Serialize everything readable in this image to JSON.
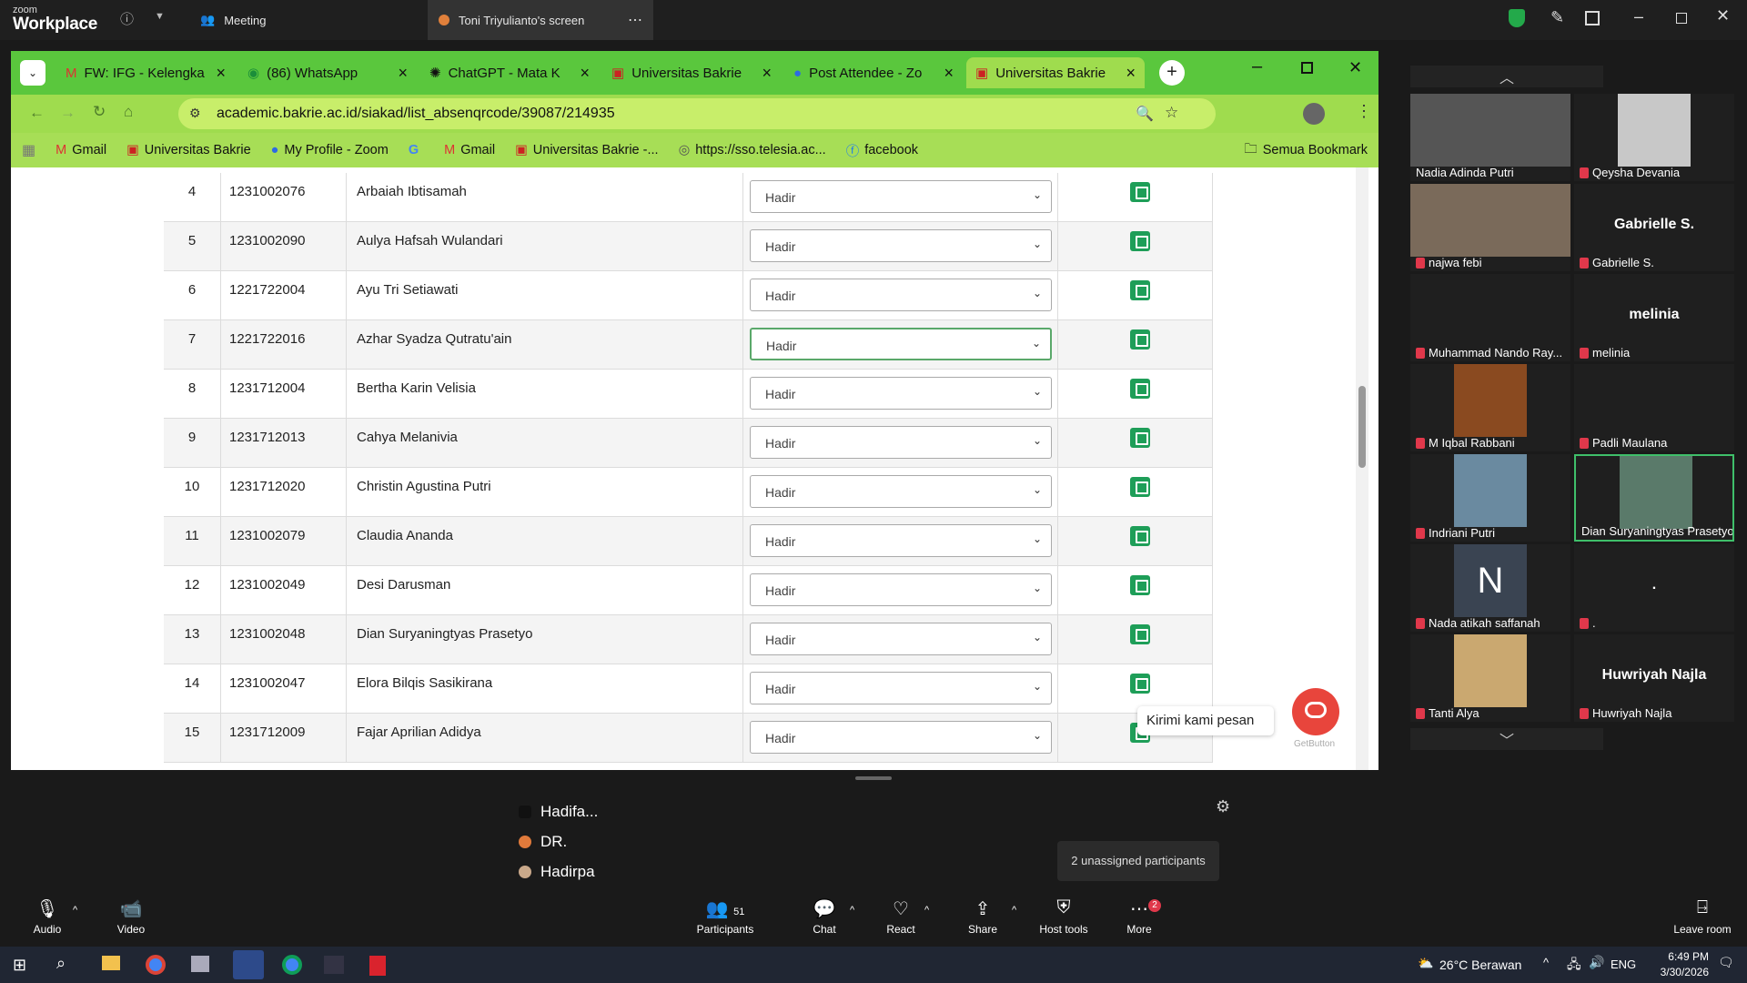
{
  "zoom": {
    "logo_top": "zoom",
    "logo_bottom": "Workplace",
    "meeting_tab": "Meeting",
    "share_tab": "Toni Triyulianto's screen"
  },
  "browser": {
    "tabs": [
      {
        "label": "FW: IFG - Kelengka"
      },
      {
        "label": "(86) WhatsApp"
      },
      {
        "label": "ChatGPT - Mata K"
      },
      {
        "label": "Universitas Bakrie"
      },
      {
        "label": "Post Attendee - Zo"
      },
      {
        "label": "Universitas Bakrie"
      }
    ],
    "url": "academic.bakrie.ac.id/siakad/list_absenqrcode/39087/214935",
    "bookmarks": [
      {
        "label": "Gmail"
      },
      {
        "label": "Universitas Bakrie"
      },
      {
        "label": "My Profile - Zoom"
      },
      {
        "label": ""
      },
      {
        "label": "Gmail"
      },
      {
        "label": "Universitas Bakrie -..."
      },
      {
        "label": "https://sso.telesia.ac..."
      },
      {
        "label": "facebook"
      }
    ],
    "bookmark_folder": "Semua Bookmark",
    "select_options": [
      "Hadir"
    ],
    "students": [
      {
        "no": "4",
        "nim": "1231002076",
        "name": "Arbaiah Ibtisamah",
        "status": "Hadir"
      },
      {
        "no": "5",
        "nim": "1231002090",
        "name": "Aulya Hafsah Wulandari",
        "status": "Hadir"
      },
      {
        "no": "6",
        "nim": "1221722004",
        "name": "Ayu Tri Setiawati",
        "status": "Hadir"
      },
      {
        "no": "7",
        "nim": "1221722016",
        "name": "Azhar Syadza Qutratu'ain",
        "status": "Hadir"
      },
      {
        "no": "8",
        "nim": "1231712004",
        "name": "Bertha Karin Velisia",
        "status": "Hadir"
      },
      {
        "no": "9",
        "nim": "1231712013",
        "name": "Cahya Melanivia",
        "status": "Hadir"
      },
      {
        "no": "10",
        "nim": "1231712020",
        "name": "Christin Agustina Putri",
        "status": "Hadir"
      },
      {
        "no": "11",
        "nim": "1231002079",
        "name": "Claudia Ananda",
        "status": "Hadir"
      },
      {
        "no": "12",
        "nim": "1231002049",
        "name": "Desi Darusman",
        "status": "Hadir"
      },
      {
        "no": "13",
        "nim": "1231002048",
        "name": "Dian Suryaningtyas Prasetyo",
        "status": "Hadir"
      },
      {
        "no": "14",
        "nim": "1231002047",
        "name": "Elora Bilqis Sasikirana",
        "status": "Hadir"
      },
      {
        "no": "15",
        "nim": "1231712009",
        "name": "Fajar Aprilian Adidya",
        "status": "Hadir"
      }
    ],
    "chat_widget": "Kirimi kami pesan",
    "chat_brand": "GetButton"
  },
  "gallery": [
    {
      "name": "Nadia Adinda Putri",
      "muted": false,
      "big": ""
    },
    {
      "name": "Qeysha Devania",
      "muted": true,
      "big": ""
    },
    {
      "name": "najwa febi",
      "muted": true,
      "big": ""
    },
    {
      "name": "Gabrielle S.",
      "muted": true,
      "big": "Gabrielle S."
    },
    {
      "name": "Muhammad Nando Ray...",
      "muted": true,
      "big": ""
    },
    {
      "name": "melinia",
      "muted": true,
      "big": "melinia"
    },
    {
      "name": "M Iqbal Rabbani",
      "muted": true,
      "big": ""
    },
    {
      "name": "Padli Maulana",
      "muted": true,
      "big": ""
    },
    {
      "name": "Indriani Putri",
      "muted": true,
      "big": ""
    },
    {
      "name": "Dian Suryaningtyas Prasetyo",
      "muted": false,
      "big": ""
    },
    {
      "name": "Nada atikah saffanah",
      "muted": true,
      "big": "",
      "initial": "N"
    },
    {
      "name": ".",
      "muted": true,
      "big": "."
    },
    {
      "name": "Tanti Alya",
      "muted": true,
      "big": ""
    },
    {
      "name": "Huwriyah Najla",
      "muted": true,
      "big": "Huwriyah Najla"
    }
  ],
  "breakout": {
    "participants": [
      "Hadifa...",
      "DR.",
      "Hadirpa"
    ],
    "unassigned": "2 unassigned participants"
  },
  "toolbar": {
    "audio": "Audio",
    "video": "Video",
    "participants": "Participants",
    "participants_count": "51",
    "chat": "Chat",
    "react": "React",
    "share": "Share",
    "host_tools": "Host tools",
    "more": "More",
    "more_badge": "2",
    "leave": "Leave room"
  },
  "taskbar": {
    "weather": "26°C  Berawan",
    "lang": "ENG",
    "time": "6:49 PM",
    "date": "3/30/2026"
  },
  "colors": {
    "browser_green": "#5ac73d",
    "save_green": "#1e9e58",
    "mute_red": "#e0384b"
  }
}
